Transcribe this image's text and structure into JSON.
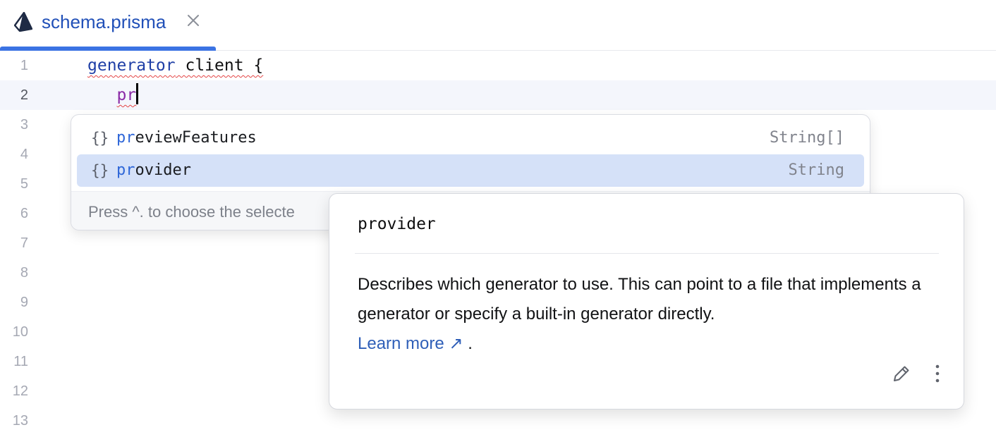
{
  "tab": {
    "title": "schema.prisma",
    "icon": "prisma-icon",
    "close_icon": "close-icon"
  },
  "editor": {
    "line_numbers": [
      "1",
      "2",
      "3",
      "4",
      "5",
      "6",
      "7",
      "8",
      "9",
      "10",
      "11",
      "12",
      "13"
    ],
    "active_line": "2",
    "lines": {
      "l1_keyword": "generator",
      "l1_rest": " client {",
      "l2_indent": "   ",
      "l2_typed": "pr"
    }
  },
  "completion": {
    "items": [
      {
        "icon": "{}",
        "match": "pr",
        "rest": "eviewFeatures",
        "type": "String[]"
      },
      {
        "icon": "{}",
        "match": "pr",
        "rest": "ovider",
        "type": "String"
      }
    ],
    "selected_index": 1,
    "footer": "Press ^. to choose the selecte"
  },
  "doc": {
    "title": "provider",
    "body": "Describes which generator to use. This can point to a file that implements a generator or specify a built-in generator directly.",
    "link_text": "Learn more",
    "link_arrow": "↗",
    "trailing": ".",
    "edit_icon": "pencil-icon",
    "more_icon": "more-vertical-icon"
  },
  "colors": {
    "accent": "#3b73e3",
    "selection": "#d5e1f8",
    "keyword": "#1f3fa6",
    "error_squiggle": "#e44545",
    "link": "#2f5fb8"
  }
}
